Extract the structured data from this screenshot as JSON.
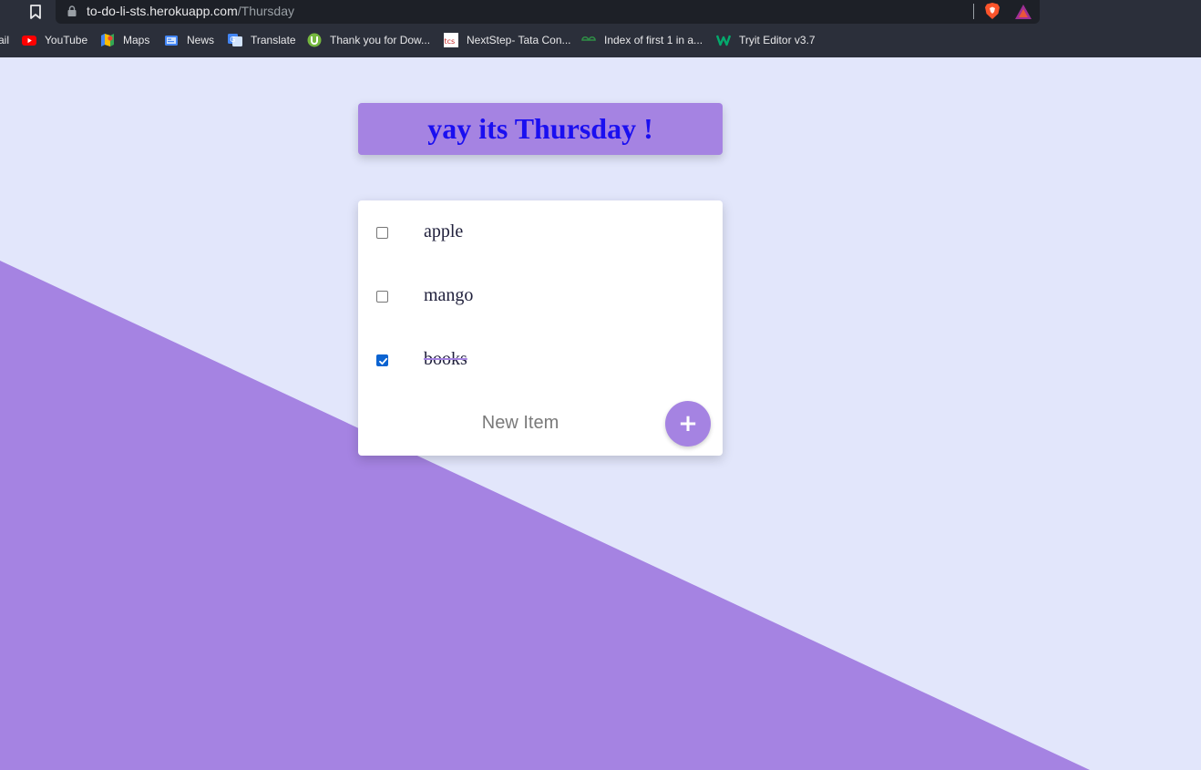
{
  "browser": {
    "url_host": "to-do-li-sts.herokuapp.com",
    "url_path": "/Thursday",
    "bookmarks": [
      {
        "label": "ail",
        "icon": "gmail-icon"
      },
      {
        "label": "YouTube",
        "icon": "youtube-icon"
      },
      {
        "label": "Maps",
        "icon": "maps-icon"
      },
      {
        "label": "News",
        "icon": "news-icon"
      },
      {
        "label": "Translate",
        "icon": "translate-icon"
      },
      {
        "label": "Thank you for Dow...",
        "icon": "utorrent-icon"
      },
      {
        "label": "NextStep- Tata Con...",
        "icon": "tcs-icon"
      },
      {
        "label": "Index of first 1 in a...",
        "icon": "geeksforgeeks-icon"
      },
      {
        "label": "Tryit Editor v3.7",
        "icon": "w3schools-icon"
      }
    ]
  },
  "page": {
    "heading": "yay its Thursday !",
    "items": [
      {
        "label": "apple",
        "checked": false
      },
      {
        "label": "mango",
        "checked": false
      },
      {
        "label": "books",
        "checked": true
      }
    ],
    "new_item_placeholder": "New Item",
    "add_button_label": "+"
  },
  "colors": {
    "background": "#e2e6fb",
    "accent": "#a583e2",
    "heading_text": "#1a0ff0",
    "checkbox_checked": "#0b63d1"
  }
}
